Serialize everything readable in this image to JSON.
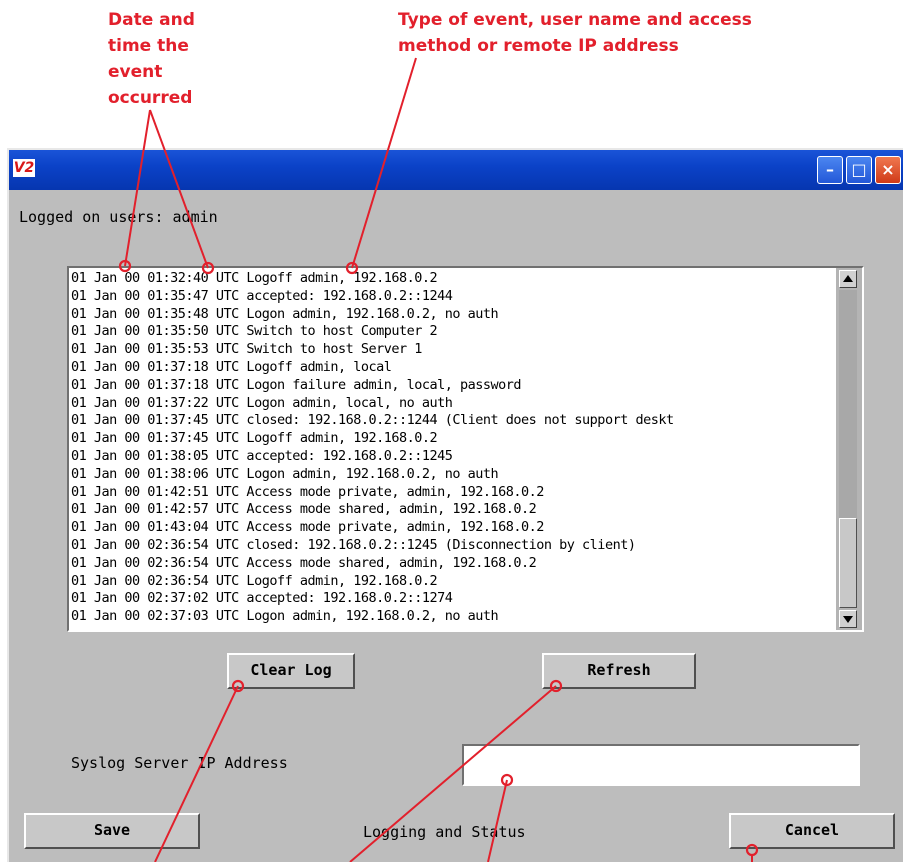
{
  "annotations": {
    "date_time": "Date and time the event occurred",
    "event_type": "Type of event, user name and access method or remote IP address"
  },
  "window": {
    "icon_text": "V2",
    "minimize_label": "–",
    "maximize_label": "□",
    "close_label": "×"
  },
  "logged_on": {
    "text": "Logged on users:  admin"
  },
  "log": {
    "lines": [
      "01 Jan 00 01:32:40 UTC Logoff admin, 192.168.0.2",
      "01 Jan 00 01:35:47 UTC accepted: 192.168.0.2::1244",
      "01 Jan 00 01:35:48 UTC Logon admin, 192.168.0.2, no auth",
      "01 Jan 00 01:35:50 UTC Switch to host Computer 2",
      "01 Jan 00 01:35:53 UTC Switch to host Server 1",
      "01 Jan 00 01:37:18 UTC Logoff admin, local",
      "01 Jan 00 01:37:18 UTC Logon failure admin, local, password",
      "01 Jan 00 01:37:22 UTC Logon admin, local, no auth",
      "01 Jan 00 01:37:45 UTC closed: 192.168.0.2::1244 (Client does not support deskt",
      "01 Jan 00 01:37:45 UTC Logoff admin, 192.168.0.2",
      "01 Jan 00 01:38:05 UTC accepted: 192.168.0.2::1245",
      "01 Jan 00 01:38:06 UTC Logon admin, 192.168.0.2, no auth",
      "01 Jan 00 01:42:51 UTC Access mode private, admin, 192.168.0.2",
      "01 Jan 00 01:42:57 UTC Access mode shared, admin, 192.168.0.2",
      "01 Jan 00 01:43:04 UTC Access mode private, admin, 192.168.0.2",
      "01 Jan 00 02:36:54 UTC closed: 192.168.0.2::1245 (Disconnection by client)",
      "01 Jan 00 02:36:54 UTC Access mode shared, admin, 192.168.0.2",
      "01 Jan 00 02:36:54 UTC Logoff admin, 192.168.0.2",
      "01 Jan 00 02:37:02 UTC accepted: 192.168.0.2::1274",
      "01 Jan 00 02:37:03 UTC Logon admin, 192.168.0.2, no auth"
    ]
  },
  "buttons": {
    "clear_log": "Clear Log",
    "refresh": "Refresh",
    "save": "Save",
    "cancel": "Cancel"
  },
  "syslog": {
    "label": "Syslog Server IP Address",
    "value": ""
  },
  "status": {
    "title": "Logging and Status"
  },
  "colors": {
    "annotation": "#e2202c",
    "titlebar": "#0b42c8",
    "window_bg": "#bdbdbd"
  }
}
